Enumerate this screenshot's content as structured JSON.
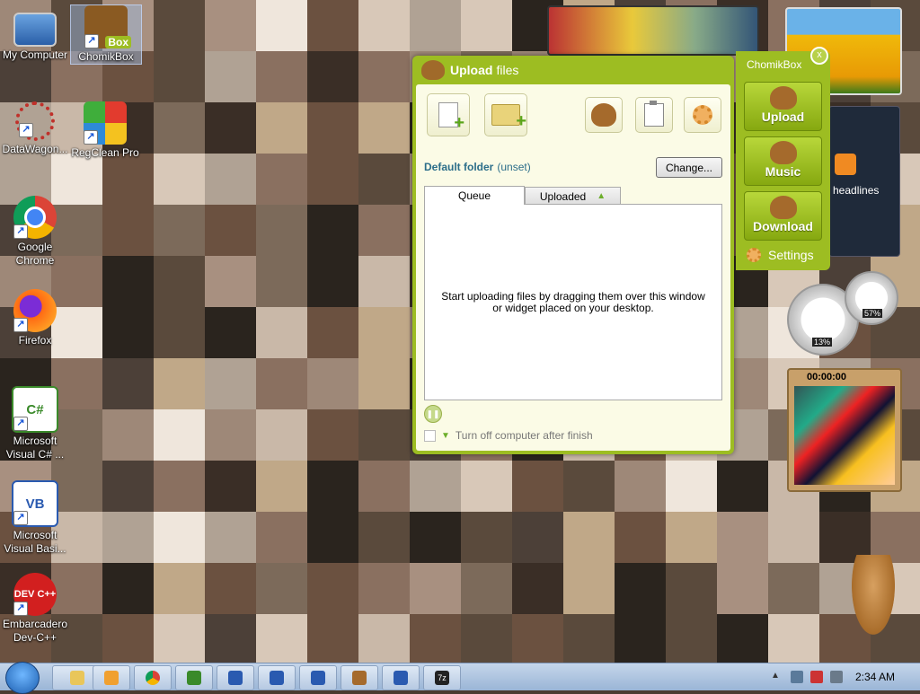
{
  "desktop": {
    "icons": [
      {
        "label": "My Computer",
        "icon": "computer-icon"
      },
      {
        "label": "ChomikBox",
        "icon": "chomikbox-icon",
        "badge": "Box"
      },
      {
        "label": "DataWagon...",
        "icon": "datawagon-icon"
      },
      {
        "label": "RegClean Pro",
        "icon": "regclean-icon"
      },
      {
        "label": "Google Chrome",
        "icon": "chrome-icon"
      },
      {
        "label": "Firefox",
        "icon": "firefox-icon"
      },
      {
        "label": "Microsoft Visual C# ...",
        "icon": "visual-csharp-icon",
        "glyph": "C#"
      },
      {
        "label": "Microsoft Visual Basi...",
        "icon": "visual-basic-icon",
        "glyph": "VB"
      },
      {
        "label": "Embarcadero Dev-C++",
        "icon": "devcpp-icon",
        "glyph": "DEV C++"
      }
    ]
  },
  "upload_window": {
    "title_bold": "Upload",
    "title_rest": "files",
    "toolbar": {
      "add_file": "add-file-icon",
      "add_folder": "add-folder-icon",
      "chomik": "hamster-icon",
      "clipboard": "clipboard-add-icon",
      "settings": "gear-icon"
    },
    "default_folder_label": "Default folder",
    "default_folder_value": "(unset)",
    "change_button": "Change...",
    "tabs": {
      "queue": "Queue",
      "uploaded": "Uploaded"
    },
    "empty_message": "Start uploading files by dragging them over this window or widget placed on your desktop.",
    "turn_off_label": "Turn off computer after finish"
  },
  "side_panel": {
    "title": "ChomikBox",
    "close_glyph": "x",
    "buttons": [
      {
        "label": "Upload"
      },
      {
        "label": "Music"
      },
      {
        "label": "Download"
      }
    ],
    "settings_label": "Settings"
  },
  "gadgets": {
    "headlines": "headlines",
    "cpu_percent": "13%",
    "mem_percent": "57%",
    "puzzle_timer": "00:00:00"
  },
  "taskbar": {
    "clock": "2:34 AM",
    "apps": [
      "explorer-icon",
      "media-player-icon",
      "chrome-icon",
      "csharp-icon",
      "vb-icon",
      "vb-icon",
      "vb-icon",
      "chomikbox-icon",
      "vb-icon",
      "7zip-icon"
    ],
    "zip_glyph": "7z"
  },
  "colors": {
    "brand_green": "#9dbd22",
    "link_blue": "#2c6e8a"
  }
}
